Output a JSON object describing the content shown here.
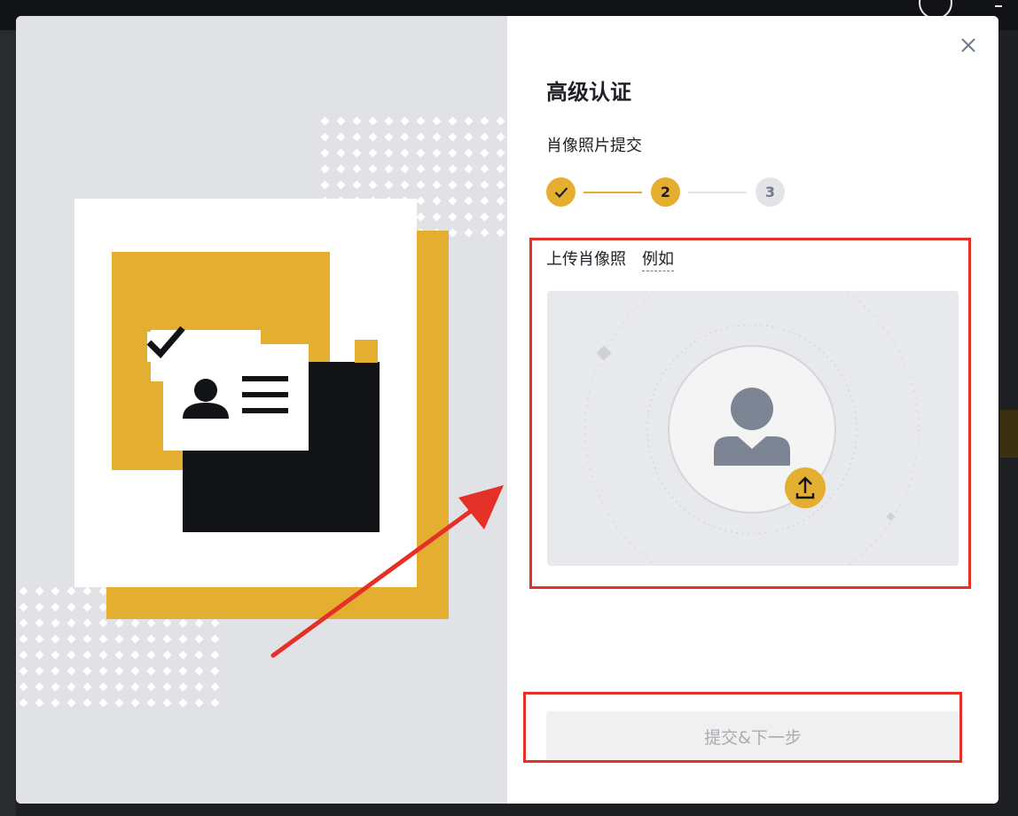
{
  "modal": {
    "title": "高级认证",
    "subtitle": "肖像照片提交",
    "steps": [
      {
        "label": "",
        "state": "done"
      },
      {
        "label": "2",
        "state": "active"
      },
      {
        "label": "3",
        "state": "pending"
      }
    ],
    "upload": {
      "label": "上传肖像照",
      "example_link": "例如"
    },
    "submit_label": "提交&下一步",
    "close_icon": "close-icon"
  },
  "colors": {
    "accent": "#e4ae30",
    "dark": "#121317",
    "illustration_bg": "#e1e2e5",
    "annotation": "#e53028"
  }
}
